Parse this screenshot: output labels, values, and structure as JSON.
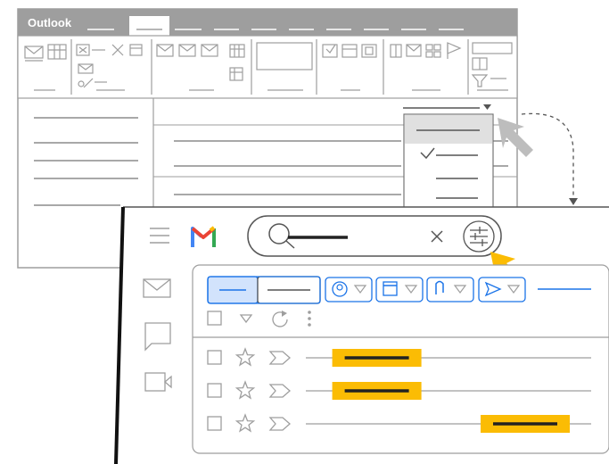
{
  "outlook": {
    "title": "Outlook",
    "tabs": [
      "",
      "",
      "",
      "",
      "",
      "",
      "",
      "",
      "",
      ""
    ],
    "active_tab_index": 1
  },
  "ribbon": {
    "icons": [
      "new-email-icon",
      "new-items-icon",
      "ignore-icon",
      "delete-icon",
      "archive-icon",
      "reply-icon",
      "reply-all-icon",
      "forward-icon",
      "meeting-icon",
      "more-icon",
      "move-icon",
      "rules-icon",
      "onenote-icon",
      "read-icon",
      "categorize-icon",
      "follow-up-icon",
      "address-book-icon",
      "filter-icon"
    ]
  },
  "sort_dropdown": {
    "options": [
      "",
      "",
      ""
    ],
    "checked_index": 1
  },
  "gmail": {
    "logo": "gmail-logo",
    "search": {
      "value": "",
      "placeholder": ""
    },
    "nav": [
      "mail-icon",
      "chat-icon",
      "meet-icon"
    ],
    "filter_chips": [
      "from-filter",
      "date-filter",
      "attachment-filter",
      "sent-filter"
    ],
    "rows": [
      {
        "highlight_pos": 0.18
      },
      {
        "highlight_pos": 0.18
      },
      {
        "highlight_pos": 0.7
      }
    ]
  },
  "colors": {
    "outlook_gray": "#9e9e9e",
    "line_gray": "#757575",
    "gmail_blue": "#1a73e8",
    "highlight_yellow": "#fbbc04",
    "arrow_gray": "#bdbdbd",
    "gmail_red": "#ea4335",
    "gmail_green": "#34a853",
    "gmail_yellow": "#fbbc04",
    "gmail_blue_logo": "#4285f4"
  }
}
